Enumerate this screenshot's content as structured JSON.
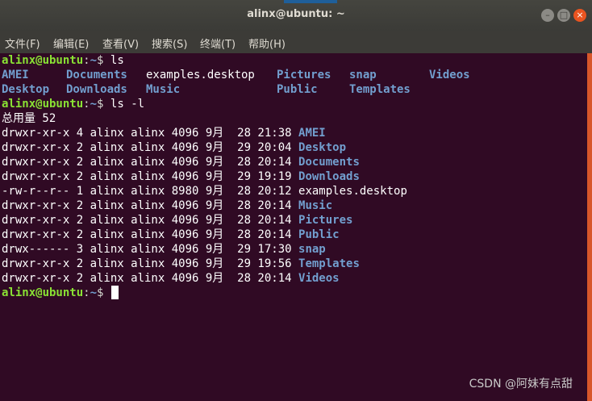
{
  "window": {
    "title": "alinx@ubuntu: ~"
  },
  "menu": [
    "文件(F)",
    "编辑(E)",
    "查看(V)",
    "搜索(S)",
    "终端(T)",
    "帮助(H)"
  ],
  "prompt": {
    "user_host": "alinx@ubuntu",
    "sep": ":",
    "path": "~",
    "symbol": "$"
  },
  "commands": [
    "ls",
    "ls -l"
  ],
  "ls_row1": [
    "AMEI",
    "Documents",
    "examples.desktop",
    "Pictures",
    "snap",
    "Videos"
  ],
  "ls_row2": [
    "Desktop",
    "Downloads",
    "Music",
    "",
    "Public",
    "Templates"
  ],
  "total_line": "总用量 52",
  "listing": [
    {
      "meta": "drwxr-xr-x 4 alinx alinx 4096 9月  28 21:38",
      "name": "AMEI",
      "type": "dir"
    },
    {
      "meta": "drwxr-xr-x 2 alinx alinx 4096 9月  29 20:04",
      "name": "Desktop",
      "type": "dir"
    },
    {
      "meta": "drwxr-xr-x 2 alinx alinx 4096 9月  28 20:14",
      "name": "Documents",
      "type": "dir"
    },
    {
      "meta": "drwxr-xr-x 2 alinx alinx 4096 9月  29 19:19",
      "name": "Downloads",
      "type": "dir"
    },
    {
      "meta": "-rw-r--r-- 1 alinx alinx 8980 9月  28 20:12",
      "name": "examples.desktop",
      "type": "file"
    },
    {
      "meta": "drwxr-xr-x 2 alinx alinx 4096 9月  28 20:14",
      "name": "Music",
      "type": "dir"
    },
    {
      "meta": "drwxr-xr-x 2 alinx alinx 4096 9月  28 20:14",
      "name": "Pictures",
      "type": "dir"
    },
    {
      "meta": "drwxr-xr-x 2 alinx alinx 4096 9月  28 20:14",
      "name": "Public",
      "type": "dir"
    },
    {
      "meta": "drwx------ 3 alinx alinx 4096 9月  29 17:30",
      "name": "snap",
      "type": "dir"
    },
    {
      "meta": "drwxr-xr-x 2 alinx alinx 4096 9月  29 19:56",
      "name": "Templates",
      "type": "dir"
    },
    {
      "meta": "drwxr-xr-x 2 alinx alinx 4096 9月  28 20:14",
      "name": "Videos",
      "type": "dir"
    }
  ],
  "watermark": "CSDN @阿妹有点甜",
  "colors": {
    "background": "#300a24",
    "prompt_user": "#8ae234",
    "directory": "#729fcf",
    "scrollbar": "#d8562a",
    "close_button": "#e95420"
  },
  "icons": {
    "minimize": "minimize-icon",
    "maximize": "maximize-icon",
    "close": "close-icon"
  }
}
